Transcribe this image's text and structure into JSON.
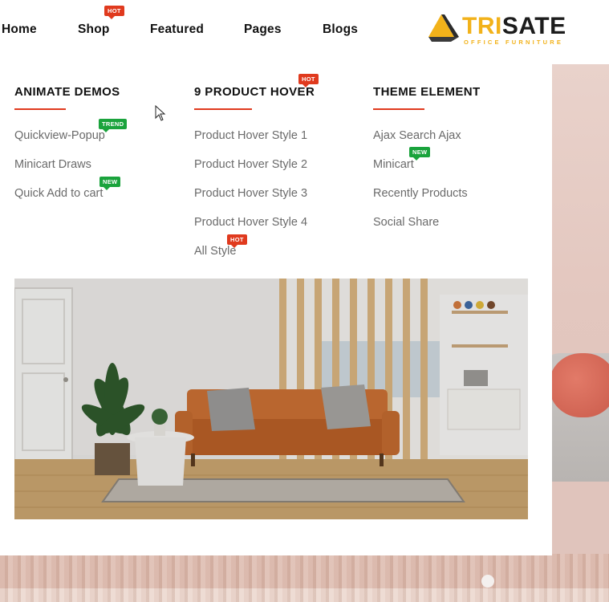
{
  "nav": {
    "items": [
      {
        "label": "Home"
      },
      {
        "label": "Shop",
        "badge": "HOT"
      },
      {
        "label": "Featured"
      },
      {
        "label": "Pages"
      },
      {
        "label": "Blogs"
      }
    ]
  },
  "logo": {
    "part1": "TRI",
    "part2": "SATE",
    "sub": "OFFICE FURNITURE"
  },
  "mega": {
    "columns": [
      {
        "title": "ANIMATE DEMOS",
        "links": [
          {
            "label": "Quickview-Popup",
            "badge": "TREND"
          },
          {
            "label": "Minicart Draws"
          },
          {
            "label": "Quick Add to cart",
            "badge": "NEW"
          }
        ]
      },
      {
        "title": "9 PRODUCT HOVER",
        "title_badge": "HOT",
        "links": [
          {
            "label": "Product Hover Style 1"
          },
          {
            "label": "Product Hover Style 2"
          },
          {
            "label": "Product Hover Style 3"
          },
          {
            "label": "Product Hover Style 4"
          },
          {
            "label": "All Style",
            "badge": "HOT"
          }
        ]
      },
      {
        "title": "THEME ELEMENT",
        "links": [
          {
            "label": "Ajax Search Ajax"
          },
          {
            "label": "Minicart",
            "badge": "NEW"
          },
          {
            "label": "Recently Products"
          },
          {
            "label": "Social Share"
          }
        ]
      }
    ]
  },
  "colors": {
    "accent": "#e03a1e",
    "badge_hot": "#e03a1e",
    "badge_new": "#1aa33c",
    "logo_yellow": "#f2b21a"
  }
}
